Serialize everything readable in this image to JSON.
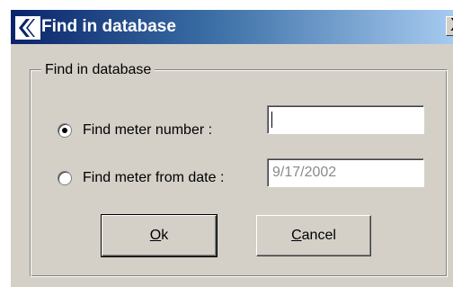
{
  "window": {
    "title": "Find in database",
    "title_icon": "database-app-icon",
    "close_glyph": "X"
  },
  "group": {
    "label": "Find in database"
  },
  "options": [
    {
      "label": "Find meter number :",
      "selected": true
    },
    {
      "label": "Find meter from date :",
      "selected": false
    }
  ],
  "fields": {
    "meter_number": {
      "value": ""
    },
    "from_date": {
      "value": "9/17/2002"
    }
  },
  "buttons": {
    "ok": "Ok",
    "cancel": "Cancel"
  },
  "colors": {
    "titlebar_start": "#0a246a",
    "titlebar_end": "#a6caf0",
    "face": "#d4d0c8"
  }
}
